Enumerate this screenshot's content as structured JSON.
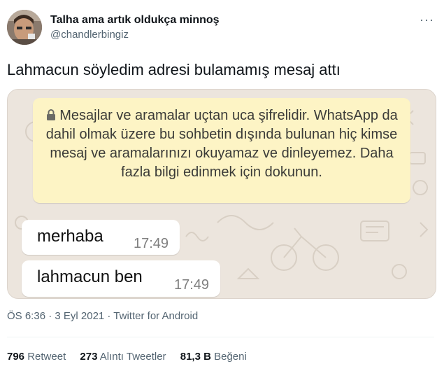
{
  "author": {
    "name": "Talha ama artık oldukça minnoş",
    "handle": "@chandlerbingiz"
  },
  "more_menu_glyph": "···",
  "tweet": {
    "text": "Lahmacun söyledim adresi bulamamış mesaj attı"
  },
  "whatsapp": {
    "encryption_notice": "Mesajlar ve aramalar uçtan uca şifrelidir. WhatsApp da dahil olmak üzere bu sohbetin dışında bulunan hiç kimse mesaj ve aramalarınızı okuyamaz ve dinleyemez. Daha fazla bilgi edinmek için dokunun.",
    "messages": [
      {
        "text": "merhaba",
        "time": "17:49"
      },
      {
        "text": "lahmacun ben",
        "time": "17:49"
      }
    ],
    "colors": {
      "chat_bg": "#ece5dd",
      "notice_bg": "#fdf4c5",
      "bubble_bg": "#ffffff"
    }
  },
  "meta": "ÖS 6:36 · 3 Eyl 2021 · Twitter for Android",
  "stats": {
    "retweets_count": "796",
    "retweets_label": "Retweet",
    "quotes_count": "273",
    "quotes_label": "Alıntı Tweetler",
    "likes_count": "81,3 B",
    "likes_label": "Beğeni"
  }
}
